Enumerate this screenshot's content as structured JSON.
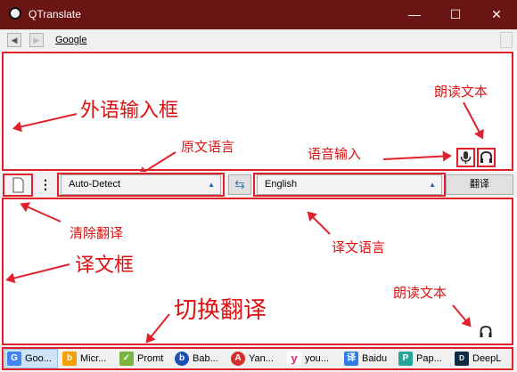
{
  "window": {
    "title": "QTranslate",
    "minimize": "—",
    "maximize": "☐",
    "close": "✕"
  },
  "nav": {
    "back": "◀",
    "forward": "▶",
    "provider": "Google"
  },
  "annotations": {
    "source_box": "外语输入框",
    "read_aloud_top": "朗读文本",
    "source_lang": "原文语言",
    "voice_input": "语音输入",
    "clear": "清除翻译",
    "target_lang": "译文语言",
    "result_box": "译文框",
    "switch": "切换翻译",
    "read_aloud_bottom": "朗读文本"
  },
  "toolbar": {
    "source_language": "Auto-Detect",
    "swap_icon": "⇆",
    "target_language": "English",
    "translate_button": "翻译",
    "more": "⋮"
  },
  "tabs": [
    {
      "label": "Goo...",
      "icon": "G",
      "color": "#4285f4"
    },
    {
      "label": "Micr...",
      "icon": "b",
      "color": "#f5a000"
    },
    {
      "label": "Promt",
      "icon": "✓",
      "color": "#7cb342"
    },
    {
      "label": "Bab...",
      "icon": "b",
      "color": "#1a4fb5"
    },
    {
      "label": "Yan...",
      "icon": "A",
      "color": "#d32f2f"
    },
    {
      "label": "you...",
      "icon": "y",
      "color": "#e91e63"
    },
    {
      "label": "Baidu",
      "icon": "译",
      "color": "#2f7de1"
    },
    {
      "label": "Pap...",
      "icon": "P",
      "color": "#26a69a"
    },
    {
      "label": "DeepL",
      "icon": "D",
      "color": "#0f2b46"
    }
  ]
}
